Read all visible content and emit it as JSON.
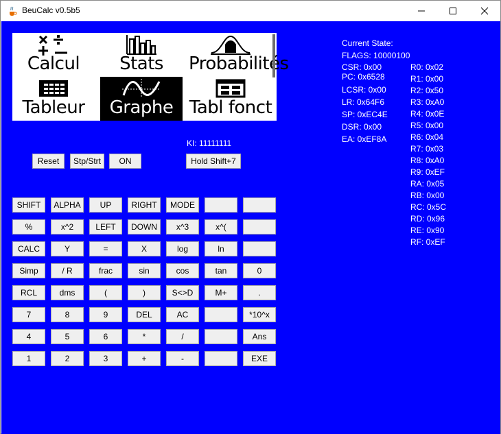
{
  "window": {
    "title": "BeuCalc v0.5b5"
  },
  "menu": {
    "items": [
      {
        "label": "Calcul",
        "icon": "calcul-icon"
      },
      {
        "label": "Stats",
        "icon": "stats-icon"
      },
      {
        "label": "Probabilités",
        "icon": "probabilites-icon"
      },
      {
        "label": "Tableur",
        "icon": "tableur-icon"
      },
      {
        "label": "Graphe",
        "icon": "graphe-icon",
        "selected": true
      },
      {
        "label": "Tabl fonct",
        "icon": "tabl-fonct-icon"
      }
    ]
  },
  "ki": "KI: 11111111",
  "controls": {
    "reset": "Reset",
    "stpstrt": "Stp/Strt",
    "on": "ON",
    "hold_shift": "Hold Shift+7"
  },
  "keypad": {
    "rows": [
      [
        "SHIFT",
        "ALPHA",
        "UP",
        "RIGHT",
        "MODE",
        "",
        ""
      ],
      [
        "%",
        "x^2",
        "LEFT",
        "DOWN",
        "x^3",
        "x^(",
        ""
      ],
      [
        "CALC",
        "Y",
        "=",
        "X",
        "log",
        "ln",
        ""
      ],
      [
        "Simp",
        "/ R",
        "frac",
        "sin",
        "cos",
        "tan",
        "0"
      ],
      [
        "RCL",
        "dms",
        "(",
        ")",
        "S<>D",
        "M+",
        "."
      ],
      [
        "7",
        "8",
        "9",
        "DEL",
        "AC",
        "",
        "*10^x"
      ],
      [
        "4",
        "5",
        "6",
        "*",
        "/",
        "",
        "Ans"
      ],
      [
        "1",
        "2",
        "3",
        "+",
        "-",
        "",
        "EXE"
      ]
    ]
  },
  "state": {
    "heading": "Current State:",
    "flags": "FLAGS: 10000100",
    "left": [
      "CSR: 0x00",
      "PC: 0x6528",
      "LCSR: 0x00",
      "LR: 0x64F6",
      "SP: 0xEC4E",
      "DSR: 0x00",
      "EA: 0xEF8A"
    ],
    "registers": [
      "R0: 0x02",
      "R1: 0x00",
      "R2: 0x50",
      "R3: 0xA0",
      "R4: 0x0E",
      "R5: 0x00",
      "R6: 0x04",
      "R7: 0x03",
      "R8: 0xA0",
      "R9: 0xEF",
      "RA: 0x05",
      "RB: 0x00",
      "RC: 0x5C",
      "RD: 0x96",
      "RE: 0x90",
      "RF: 0xEF"
    ]
  }
}
